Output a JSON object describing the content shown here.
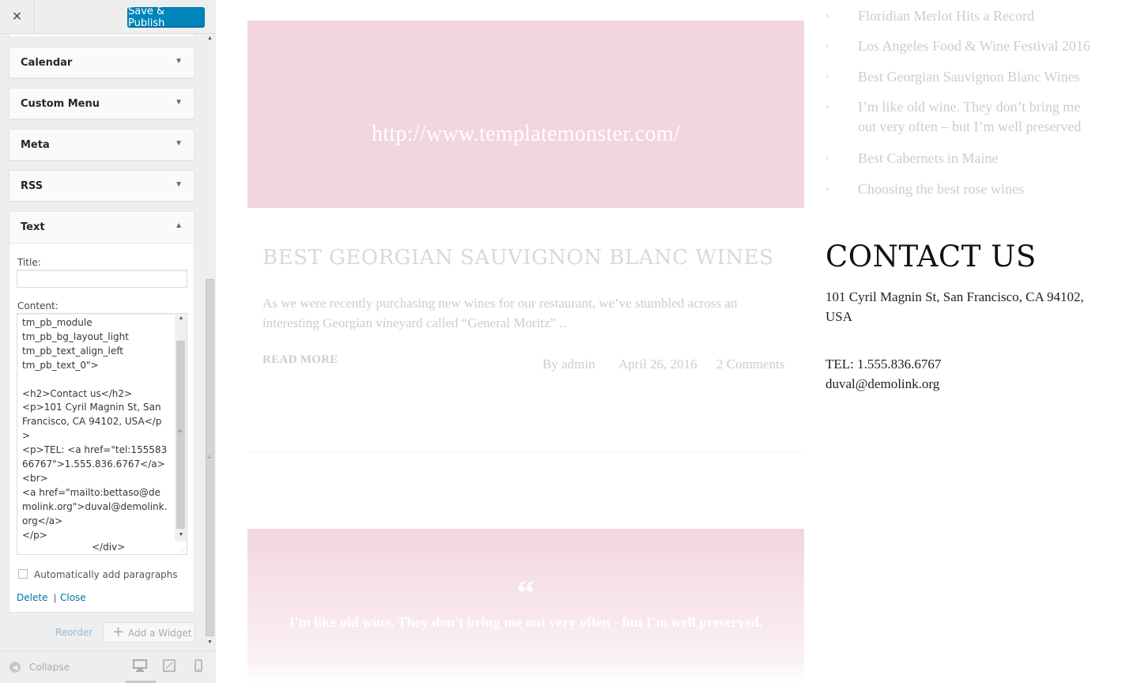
{
  "customizer": {
    "close_label": "×",
    "publish_label": "Save & Publish",
    "widgets": [
      {
        "title": "Calendar",
        "arrow": "▼"
      },
      {
        "title": "Custom Menu",
        "arrow": "▼"
      },
      {
        "title": "Meta",
        "arrow": "▼"
      },
      {
        "title": "RSS",
        "arrow": "▼"
      }
    ],
    "text_widget": {
      "title": "Text",
      "arrow": "▲",
      "title_label": "Title:",
      "title_value": "",
      "content_label": "Content:",
      "content_value": "tm_pb_module\ntm_pb_bg_layout_light\ntm_pb_text_align_left\ntm_pb_text_0\">\n\n<h2>Contact us</h2>\n<p>101 Cyril Magnin St, San Francisco, CA 94102, USA</p>\n<p>TEL: <a href=\"tel:15558366767\">1.555.836.6767</a><br>\n<a href=\"mailto:bettaso@demolink.org\">duval@demolink.org</a>\n</p>",
      "content_tail": "</div>",
      "auto_paragraphs_label": "Automatically add paragraphs",
      "delete_label": "Delete",
      "separator": "|",
      "close_label": "Close"
    },
    "reorder_label": "Reorder",
    "add_widget_label": "Add a Widget",
    "collapse_label": "Collapse"
  },
  "preview": {
    "post": {
      "image_url_text": "http://www.templatemonster.com/",
      "title": "BEST GEORGIAN SAUVIGNON BLANC WINES",
      "excerpt": "As we were recently purchasing new wines for our restaurant, we’ve stumbled across an interesting Georgian vineyard called “General Moritz” ..",
      "read_more": "READ MORE",
      "author": "By admin",
      "date": "April 26, 2016",
      "comments": "2 Comments"
    },
    "quote": {
      "mark": "“",
      "text": "I'm like old wine. They don't bring me out very often - but I'm well preserved."
    },
    "recent_posts": [
      "Floridian Merlot Hits a Record",
      "Los Angeles Food & Wine Festival 2016",
      "Best Georgian Sauvignon Blanc Wines",
      "I’m like old wine. They don’t bring me out very often – but I’m well preserved",
      "Best Cabernets in Maine",
      "Choosing the best rose wines"
    ],
    "contact": {
      "heading": "CONTACT US",
      "address": "101 Cyril Magnin St, San Francisco, CA 94102, USA",
      "tel": "TEL: 1.555.836.6767",
      "email": "duval@demolink.org"
    }
  },
  "colors": {
    "publish_button": "#0085ba",
    "link": "#0073aa",
    "post_image_bg": "#f2d6dd",
    "faded_text": "#cccccc"
  }
}
